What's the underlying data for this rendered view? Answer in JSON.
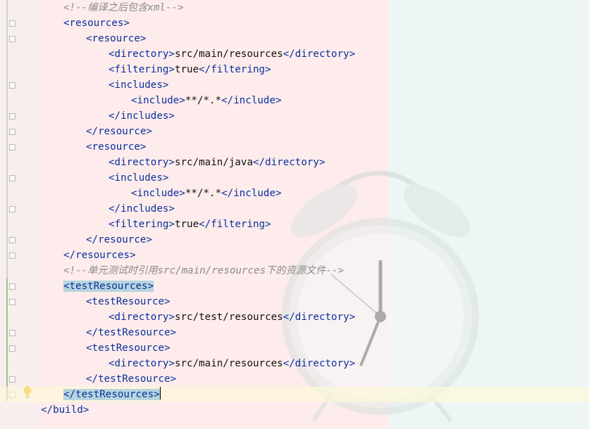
{
  "editor": {
    "lines": [
      {
        "indent": 1,
        "comment": "<!--编译之后包含xml-->"
      },
      {
        "indent": 1,
        "tag": "<resources>"
      },
      {
        "indent": 2,
        "tag": "<resource>"
      },
      {
        "indent": 3,
        "open": "<directory>",
        "text": "src/main/resources",
        "close": "</directory>"
      },
      {
        "indent": 3,
        "open": "<filtering>",
        "text": "true",
        "close": "</filtering>"
      },
      {
        "indent": 3,
        "tag": "<includes>"
      },
      {
        "indent": 4,
        "open": "<include>",
        "text": "**/*.*",
        "close": "</include>"
      },
      {
        "indent": 3,
        "tag": "</includes>"
      },
      {
        "indent": 2,
        "tag": "</resource>"
      },
      {
        "indent": 2,
        "tag": "<resource>"
      },
      {
        "indent": 3,
        "open": "<directory>",
        "text": "src/main/java",
        "close": "</directory>"
      },
      {
        "indent": 3,
        "tag": "<includes>"
      },
      {
        "indent": 4,
        "open": "<include>",
        "text": "**/*.*",
        "close": "</include>"
      },
      {
        "indent": 3,
        "tag": "</includes>"
      },
      {
        "indent": 3,
        "open": "<filtering>",
        "text": "true",
        "close": "</filtering>"
      },
      {
        "indent": 2,
        "tag": "</resource>"
      },
      {
        "indent": 1,
        "tag": "</resources>"
      },
      {
        "indent": 1,
        "comment": "<!--单元测试时引用src/main/resources下的资源文件-->"
      },
      {
        "indent": 1,
        "tag": "<testResources>",
        "highlight": true
      },
      {
        "indent": 2,
        "tag": "<testResource>"
      },
      {
        "indent": 3,
        "open": "<directory>",
        "text": "src/test/resources",
        "close": "</directory>"
      },
      {
        "indent": 2,
        "tag": "</testResource>"
      },
      {
        "indent": 2,
        "tag": "<testResource>"
      },
      {
        "indent": 3,
        "open": "<directory>",
        "text": "src/main/resources",
        "close": "</directory>"
      },
      {
        "indent": 2,
        "tag": "</testResource>"
      },
      {
        "indent": 1,
        "tag": "</testResources>",
        "highlight": true,
        "caret": true
      },
      {
        "indent": 0,
        "tag": "</build>"
      }
    ]
  },
  "gutter": {
    "fold_marker_rows": [
      1,
      2,
      5,
      7,
      8,
      9,
      11,
      13,
      15,
      16,
      18,
      19,
      21,
      22,
      24,
      25
    ],
    "intention_icon": "lightbulb-icon"
  },
  "colors": {
    "tag": "#0b2f9e",
    "text": "#111111",
    "comment": "#8b8b8b",
    "highlight": "#b7d5de",
    "bulb": "#f2b400"
  }
}
